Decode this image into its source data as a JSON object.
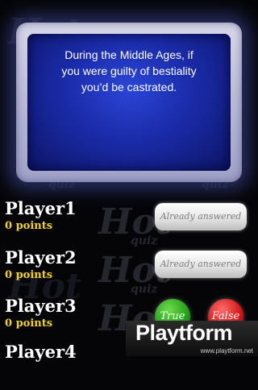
{
  "question": {
    "lines": [
      "During the Middle Ages, if",
      "you were guilty of bestiality",
      "you’d be castrated."
    ]
  },
  "watermark": {
    "word": "Hot",
    "subword": "quiz"
  },
  "players": [
    {
      "name": "Player1",
      "points": "0 points",
      "status": "Already answered"
    },
    {
      "name": "Player2",
      "points": "0 points",
      "status": "Already answered"
    },
    {
      "name": "Player3",
      "points": "0 points"
    },
    {
      "name": "Player4"
    }
  ],
  "buttons": {
    "true_label": "True",
    "false_label": "False"
  },
  "brand": {
    "logo": "Playtform",
    "url": "www.playtform.net"
  },
  "colors": {
    "question_blue": "#1a2ba8",
    "points_yellow": "#f2d21e",
    "true_green": "#26a31b",
    "false_red": "#d51919"
  }
}
